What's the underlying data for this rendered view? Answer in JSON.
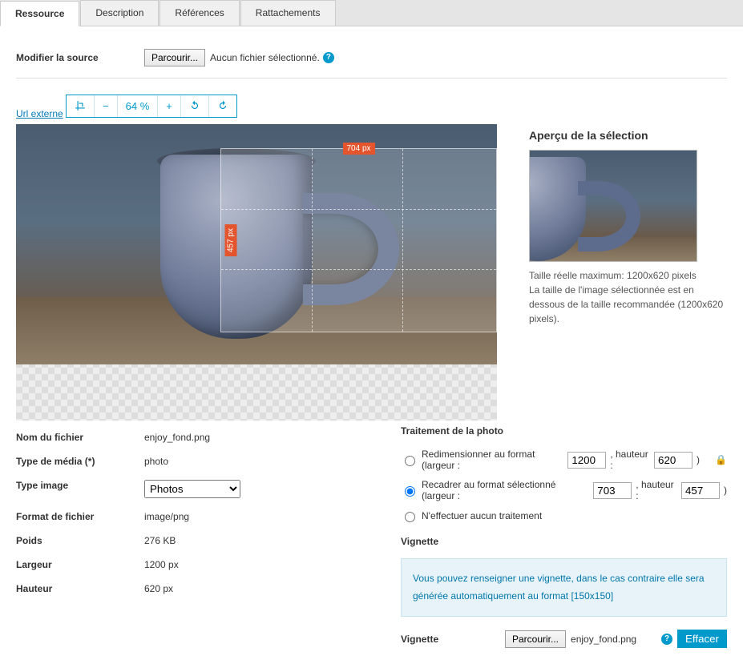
{
  "tabs": {
    "resource": "Ressource",
    "description": "Description",
    "references": "Références",
    "attachments": "Rattachements"
  },
  "source": {
    "label": "Modifier la source",
    "browse": "Parcourir...",
    "no_file": "Aucun fichier sélectionné.",
    "url_externe": "Url externe"
  },
  "toolbar": {
    "zoom_pct": "64 %"
  },
  "crop": {
    "width_label": "704 px",
    "height_label": "457 px"
  },
  "preview": {
    "title": "Aperçu de la sélection",
    "line1": "Taille réelle maximum: 1200x620 pixels",
    "line2": "La taille de l'image sélectionnée est en dessous de la taille recommandée (1200x620 pixels)."
  },
  "info": {
    "filename_k": "Nom du fichier",
    "filename_v": "enjoy_fond.png",
    "mediatype_k": "Type de média (*)",
    "mediatype_v": "photo",
    "imagetype_k": "Type image",
    "imagetype_v": "Photos",
    "format_k": "Format de fichier",
    "format_v": "image/png",
    "weight_k": "Poids",
    "weight_v": "276 KB",
    "width_k": "Largeur",
    "width_v": "1200 px",
    "height_k": "Hauteur",
    "height_v": "620 px"
  },
  "proc": {
    "title": "Traitement de la photo",
    "resize_label": "Redimensionner au format (largeur :",
    "resize_w": "1200",
    "sep": ", hauteur :",
    "resize_h": "620",
    "close": ")",
    "crop_label": "Recadrer au format sélectionné (largeur :",
    "crop_w": "703",
    "crop_h": "457",
    "none_label": "N'effectuer aucun traitement",
    "thumb_title": "Vignette",
    "thumb_info": "Vous pouvez renseigner une vignette, dans le cas contraire elle sera générée automatiquement au format [150x150]",
    "thumb_label": "Vignette",
    "thumb_browse": "Parcourir...",
    "thumb_file": "enjoy_fond.png",
    "clear": "Effacer"
  }
}
